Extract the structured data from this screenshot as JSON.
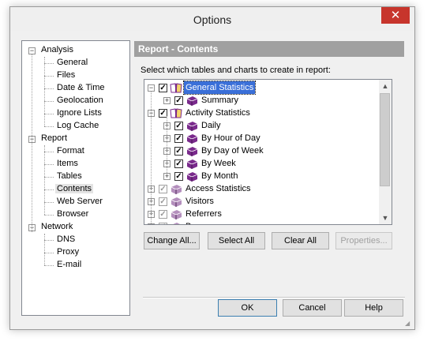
{
  "window": {
    "title": "Options",
    "close_glyph": "✕"
  },
  "nav": {
    "groups": [
      {
        "label": "Analysis",
        "expander": "−",
        "children": [
          "General",
          "Files",
          "Date & Time",
          "Geolocation",
          "Ignore Lists",
          "Log Cache"
        ]
      },
      {
        "label": "Report",
        "expander": "−",
        "children": [
          "Format",
          "Items",
          "Tables",
          "Contents",
          "Web Server",
          "Browser"
        ]
      },
      {
        "label": "Network",
        "expander": "−",
        "children": [
          "DNS",
          "Proxy",
          "E-mail"
        ]
      }
    ],
    "selected": "Contents"
  },
  "section": {
    "title": "Report - Contents",
    "instructions": "Select which tables and charts to create in report:"
  },
  "tree": {
    "items": [
      {
        "label": "General Statistics",
        "expander": "−",
        "checked": true,
        "disabled": false,
        "icon": "open-book-icon",
        "highlight": true
      },
      {
        "label": "Summary",
        "expander": "+",
        "checked": true,
        "disabled": false,
        "icon": "book-icon"
      },
      {
        "label": "Activity Statistics",
        "expander": "−",
        "checked": true,
        "disabled": false,
        "icon": "open-book-icon"
      },
      {
        "label": "Daily",
        "expander": "+",
        "checked": true,
        "disabled": false,
        "icon": "book-icon"
      },
      {
        "label": "By Hour of Day",
        "expander": "+",
        "checked": true,
        "disabled": false,
        "icon": "book-icon"
      },
      {
        "label": "By Day of Week",
        "expander": "+",
        "checked": true,
        "disabled": false,
        "icon": "book-icon"
      },
      {
        "label": "By Week",
        "expander": "+",
        "checked": true,
        "disabled": false,
        "icon": "book-icon"
      },
      {
        "label": "By Month",
        "expander": "+",
        "checked": true,
        "disabled": false,
        "icon": "book-icon"
      },
      {
        "label": "Access Statistics",
        "expander": "+",
        "checked": true,
        "disabled": true,
        "icon": "book-icon"
      },
      {
        "label": "Visitors",
        "expander": "+",
        "checked": true,
        "disabled": true,
        "icon": "book-icon"
      },
      {
        "label": "Referrers",
        "expander": "+",
        "checked": true,
        "disabled": true,
        "icon": "book-icon"
      },
      {
        "label": "Browsers",
        "expander": "+",
        "checked": true,
        "disabled": true,
        "icon": "book-icon"
      }
    ],
    "check_glyph": "✓"
  },
  "buttons": {
    "change_all": "Change All...",
    "select_all": "Select All",
    "clear_all": "Clear All",
    "properties": "Properties...",
    "ok": "OK",
    "cancel": "Cancel",
    "help": "Help"
  },
  "colors": {
    "book": "#7a2a8c",
    "selection": "#3a6fd8",
    "header": "#a0a0a0"
  }
}
